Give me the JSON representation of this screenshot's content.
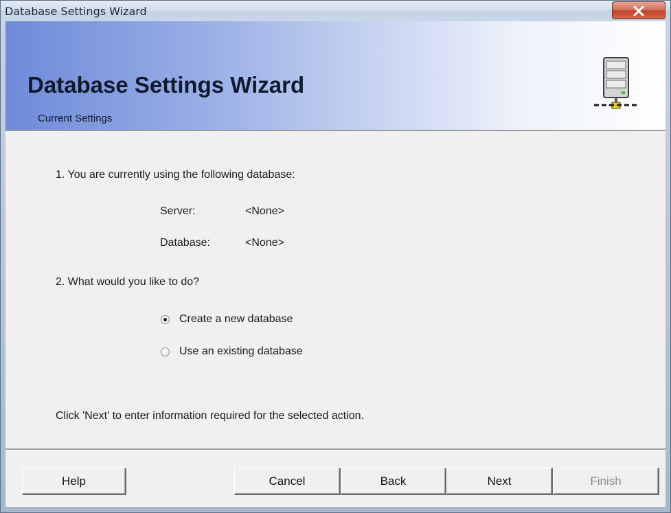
{
  "window": {
    "title": "Database Settings Wizard"
  },
  "header": {
    "title": "Database Settings Wizard",
    "subtitle": "Current Settings",
    "icon": "server-network-icon"
  },
  "content": {
    "step1": "1. You are currently using the following database:",
    "server_label": "Server:",
    "server_value": "<None>",
    "database_label": "Database:",
    "database_value": "<None>",
    "step2": "2. What would you like to do?",
    "options": [
      {
        "label": "Create a new database",
        "selected": true
      },
      {
        "label": "Use an existing database",
        "selected": false
      }
    ],
    "instruction": "Click 'Next' to enter information required for the selected action."
  },
  "buttons": {
    "help": "Help",
    "cancel": "Cancel",
    "back": "Back",
    "next": "Next",
    "finish": "Finish",
    "finish_enabled": false
  },
  "colors": {
    "close_button": "#c2432c",
    "header_gradient_start": "#6f8bd9",
    "header_gradient_end": "#ffffff"
  }
}
